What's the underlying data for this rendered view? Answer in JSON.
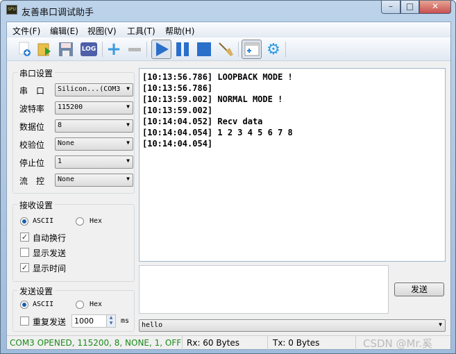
{
  "window": {
    "title": "友善串口调试助手",
    "icon_text": "SPU",
    "minimize": "–",
    "maximize": "□",
    "close": "✕"
  },
  "menu": [
    "文件(F)",
    "编辑(E)",
    "视图(V)",
    "工具(T)",
    "帮助(H)"
  ],
  "toolbar": [
    "new-icon",
    "open-icon",
    "save-icon",
    "log-icon",
    "add-icon",
    "remove-icon",
    "play-icon",
    "pause-icon",
    "stop-icon",
    "clear-broom-icon",
    "window-icon",
    "gear-icon"
  ],
  "toolbar_log": "LOG",
  "serial": {
    "title": "串口设置",
    "rows": [
      {
        "label": "串　口",
        "value": "Silicon...(COM3"
      },
      {
        "label": "波特率",
        "value": "115200"
      },
      {
        "label": "数据位",
        "value": "8"
      },
      {
        "label": "校验位",
        "value": "None"
      },
      {
        "label": "停止位",
        "value": "1"
      },
      {
        "label": "流　控",
        "value": "None"
      }
    ]
  },
  "receive": {
    "title": "接收设置",
    "ascii": "ASCII",
    "hex": "Hex",
    "mode": "ASCII",
    "options": [
      {
        "label": "自动换行",
        "checked": true
      },
      {
        "label": "显示发送",
        "checked": false
      },
      {
        "label": "显示时间",
        "checked": true
      }
    ]
  },
  "send": {
    "title": "发送设置",
    "ascii": "ASCII",
    "hex": "Hex",
    "mode": "ASCII",
    "repeat_label": "重复发送",
    "repeat_checked": false,
    "interval": "1000",
    "unit": "ms",
    "button": "发送",
    "history": "hello",
    "text": ""
  },
  "recv_text": "[10:13:56.786] LOOPBACK MODE !\n[10:13:56.786]\n[10:13:59.002] NORMAL MODE !\n[10:13:59.002]\n[10:14:04.052] Recv data\n[10:14:04.054] 1 2 3 4 5 6 7 8\n[10:14:04.054]",
  "status": {
    "port": "COM3 OPENED, 115200, 8, NONE, 1, OFF",
    "rx": "Rx: 60 Bytes",
    "tx": "Tx: 0 Bytes",
    "watermark": "CSDN @Mr.奚"
  },
  "colors": {
    "status_ok": "#1a8a1a",
    "accent": "#2a6fc9"
  }
}
